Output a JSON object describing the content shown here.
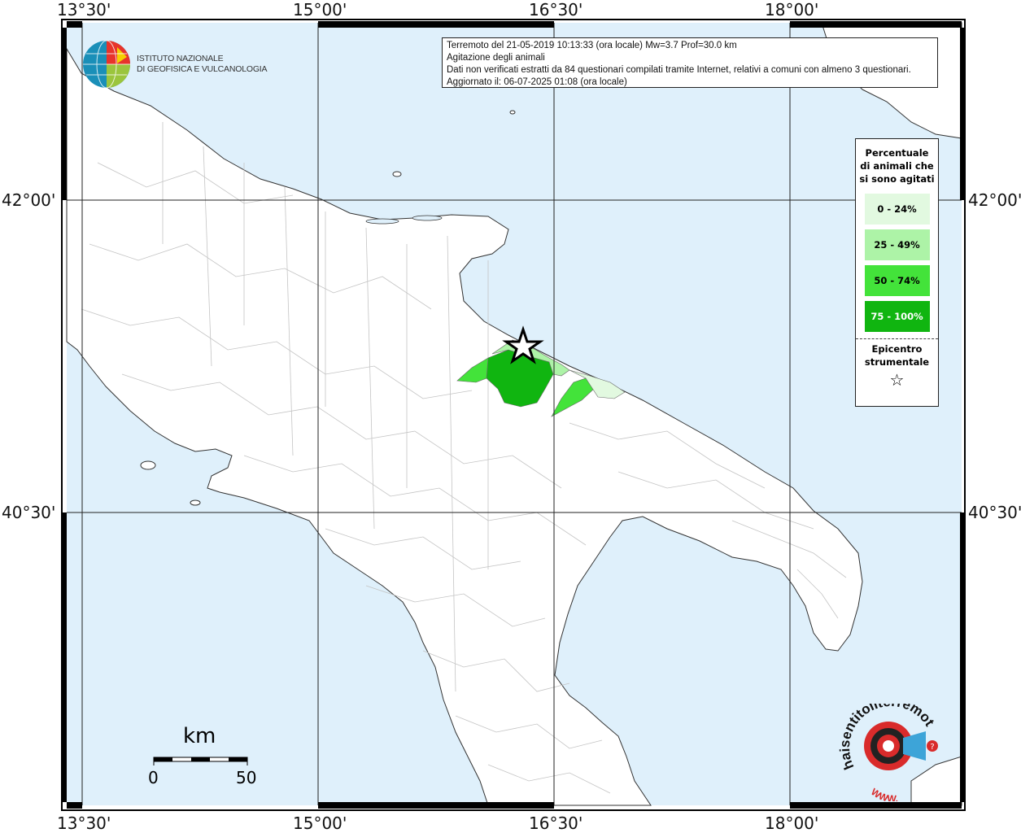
{
  "info": {
    "line1": "Terremoto del 21-05-2019 10:13:33 (ora locale) Mw=3.7 Prof=30.0 km",
    "line2": "Agitazione degli animali",
    "line3": "Dati non verificati estratti da 84 questionari compilati tramite Internet, relativi a comuni con almeno 3 questionari.",
    "line4": "Aggiornato il: 06-07-2025 01:08 (ora locale)"
  },
  "axes": {
    "lon_ticks": [
      "13°30'",
      "15°00'",
      "16°30'",
      "18°00'"
    ],
    "lat_ticks": [
      "42°00'",
      "40°30'"
    ]
  },
  "legend": {
    "title": "Percentuale di animali che si sono agitati",
    "classes": [
      {
        "label": "0 - 24%",
        "color": "#e2f9e0"
      },
      {
        "label": "25 - 49%",
        "color": "#adf3a7"
      },
      {
        "label": "50 - 74%",
        "color": "#43e33a"
      },
      {
        "label": "75 - 100%",
        "color": "#10b510"
      }
    ],
    "epicenter_label": "Epicentro strumentale",
    "epicenter_symbol": "☆"
  },
  "logo": {
    "line1": "ISTITUTO NAZIONALE",
    "line2": "DI GEOFISICA E VULCANOLOGIA"
  },
  "scalebar": {
    "unit": "km",
    "start": "0",
    "end": "50"
  },
  "hsiw": {
    "text": "haisentitoilterremoto.it",
    "www": "WWW."
  },
  "colors": {
    "sea": "#dff0fb",
    "land": "#ffffff",
    "boundary": "#b9b9b9",
    "grid": "#222222"
  }
}
